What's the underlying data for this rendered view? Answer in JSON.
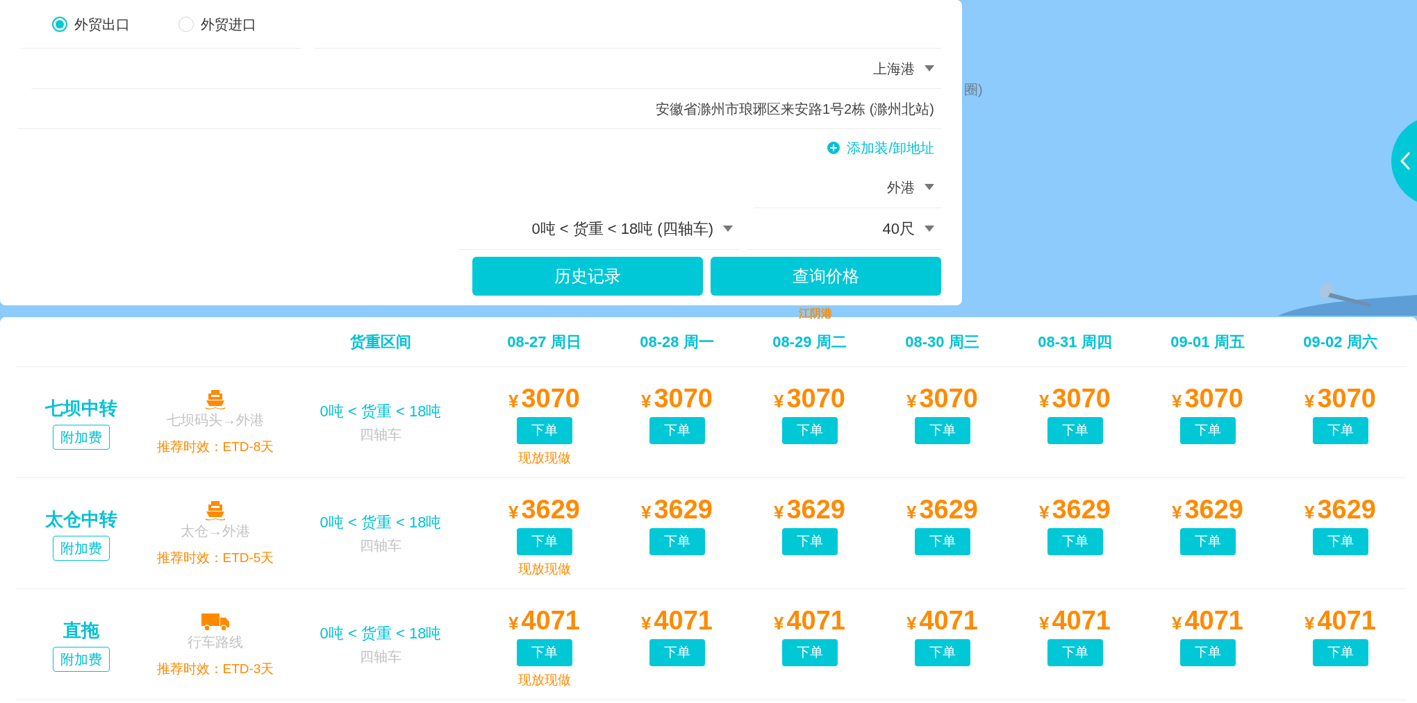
{
  "form": {
    "trade_types": [
      {
        "label": "外贸出口",
        "selected": true
      },
      {
        "label": "外贸进口",
        "selected": false
      }
    ],
    "port": "上海港",
    "address": "安徽省滁州市琅琊区来安路1号2栋 (滁州北站)",
    "add_address": "添加装/卸地址",
    "destination": "外港",
    "weight": "0吨 < 货重 < 18吨 (四轴车)",
    "container": "40尺",
    "buttons": [
      "历史记录",
      "查询价格"
    ]
  },
  "map": {
    "labels": [
      {
        "text": "圈)",
        "kind": "place"
      },
      {
        "text": "江阴港",
        "kind": "port"
      }
    ]
  },
  "table": {
    "columns": [
      "",
      "",
      "货重区间",
      "08-27 周日",
      "08-28 周一",
      "08-29 周二",
      "08-30 周三",
      "08-31 周四",
      "09-01 周五",
      "09-02 周六"
    ],
    "rows": [
      {
        "cells": [
          {
            "kind": "route",
            "name": "七坝中转",
            "surcharge": "附加费"
          },
          {
            "kind": "ship",
            "route": "七坝码头→外港",
            "etd": "推荐时效：ETD-8天"
          },
          {
            "kind": "weight",
            "weight": "0吨 < 货重 < 18吨",
            "vehicle": "四轴车"
          },
          {
            "kind": "price",
            "currency": "¥",
            "amount": "3070",
            "button": "下单",
            "note": "现放现做"
          },
          {
            "kind": "price",
            "currency": "¥",
            "amount": "3070",
            "button": "下单"
          },
          {
            "kind": "price",
            "currency": "¥",
            "amount": "3070",
            "button": "下单"
          },
          {
            "kind": "price",
            "currency": "¥",
            "amount": "3070",
            "button": "下单"
          },
          {
            "kind": "price",
            "currency": "¥",
            "amount": "3070",
            "button": "下单"
          },
          {
            "kind": "price",
            "currency": "¥",
            "amount": "3070",
            "button": "下单"
          },
          {
            "kind": "price",
            "currency": "¥",
            "amount": "3070",
            "button": "下单"
          }
        ]
      },
      {
        "cells": [
          {
            "kind": "route",
            "name": "太仓中转",
            "surcharge": "附加费"
          },
          {
            "kind": "ship",
            "route": "太仓→外港",
            "etd": "推荐时效：ETD-5天"
          },
          {
            "kind": "weight",
            "weight": "0吨 < 货重 < 18吨",
            "vehicle": "四轴车"
          },
          {
            "kind": "price",
            "currency": "¥",
            "amount": "3629",
            "button": "下单",
            "note": "现放现做"
          },
          {
            "kind": "price",
            "currency": "¥",
            "amount": "3629",
            "button": "下单"
          },
          {
            "kind": "price",
            "currency": "¥",
            "amount": "3629",
            "button": "下单"
          },
          {
            "kind": "price",
            "currency": "¥",
            "amount": "3629",
            "button": "下单"
          },
          {
            "kind": "price",
            "currency": "¥",
            "amount": "3629",
            "button": "下单"
          },
          {
            "kind": "price",
            "currency": "¥",
            "amount": "3629",
            "button": "下单"
          },
          {
            "kind": "price",
            "currency": "¥",
            "amount": "3629",
            "button": "下单"
          }
        ]
      },
      {
        "cells": [
          {
            "kind": "route",
            "name": "直拖",
            "surcharge": "附加费"
          },
          {
            "kind": "truck",
            "route": "行车路线",
            "etd": "推荐时效：ETD-3天"
          },
          {
            "kind": "weight",
            "weight": "0吨 < 货重 < 18吨",
            "vehicle": "四轴车"
          },
          {
            "kind": "price",
            "currency": "¥",
            "amount": "4071",
            "button": "下单",
            "note": "现放现做"
          },
          {
            "kind": "price",
            "currency": "¥",
            "amount": "4071",
            "button": "下单"
          },
          {
            "kind": "price",
            "currency": "¥",
            "amount": "4071",
            "button": "下单"
          },
          {
            "kind": "price",
            "currency": "¥",
            "amount": "4071",
            "button": "下单"
          },
          {
            "kind": "price",
            "currency": "¥",
            "amount": "4071",
            "button": "下单"
          },
          {
            "kind": "price",
            "currency": "¥",
            "amount": "4071",
            "button": "下单"
          },
          {
            "kind": "price",
            "currency": "¥",
            "amount": "4071",
            "button": "下单"
          }
        ]
      }
    ]
  }
}
